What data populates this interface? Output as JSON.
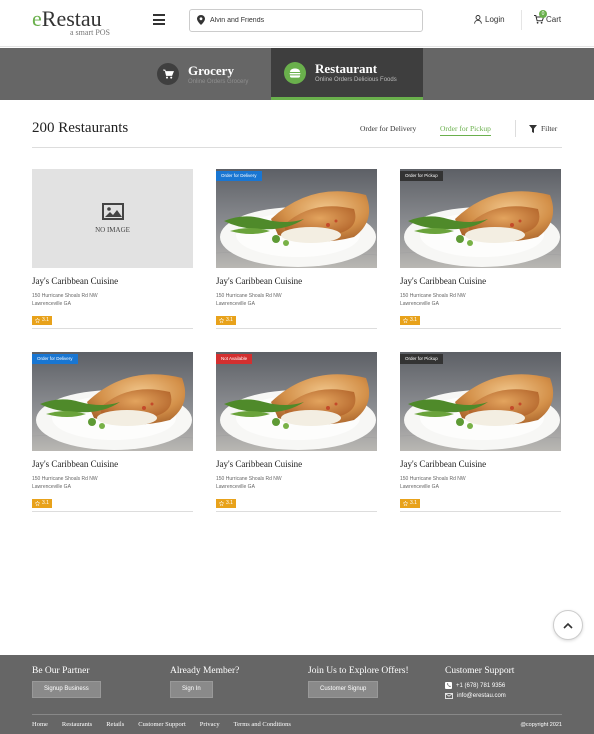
{
  "header": {
    "logo_main_e": "e",
    "logo_main_rest": "Restau",
    "logo_sub": "a smart POS",
    "search_value": "Alvin and Friends",
    "login_label": "Login",
    "cart_label": "Cart",
    "cart_count": "0",
    "accent_color": "#6ab04c"
  },
  "categories": [
    {
      "title": "Grocery",
      "subtitle": "Online Orders Grocery",
      "icon": "cart-icon"
    },
    {
      "title": "Restaurant",
      "subtitle": "Online Orders Delicious Foods",
      "icon": "burger-icon",
      "active": true
    }
  ],
  "toolbar": {
    "count_title": "200 Restaurants",
    "tab_delivery": "Order for Delivery",
    "tab_pickup": "Order for Pickup",
    "filter_label": "Filter"
  },
  "cards": [
    {
      "name": "Jay's Caribbean Cuisine",
      "addr1": "150 Hurricane Shoals Rd NW",
      "addr2": "Lawrenceville GA",
      "rating": "3.1",
      "badge": "",
      "image": "no-image",
      "noimage_label": "NO IMAGE"
    },
    {
      "name": "Jay's Caribbean Cuisine",
      "addr1": "150 Hurricane Shoals Rd NW",
      "addr2": "Lawrenceville GA",
      "rating": "3.1",
      "badge": "Order for Delivery",
      "badge_color": "#1976d2",
      "image": "food"
    },
    {
      "name": "Jay's Caribbean Cuisine",
      "addr1": "150 Hurricane Shoals Rd NW",
      "addr2": "Lawrenceville GA",
      "rating": "3.1",
      "badge": "Order for Pickup",
      "badge_color": "#333333",
      "image": "food"
    },
    {
      "name": "Jay's Caribbean Cuisine",
      "addr1": "150 Hurricane Shoals Rd NW",
      "addr2": "Lawrenceville GA",
      "rating": "3.1",
      "badge": "Order for Delivery",
      "badge_color": "#1976d2",
      "image": "food"
    },
    {
      "name": "Jay's Caribbean Cuisine",
      "addr1": "150 Hurricane Shoals Rd NW",
      "addr2": "Lawrenceville GA",
      "rating": "3.1",
      "badge": "Not Available",
      "badge_color": "#d32f2f",
      "image": "food"
    },
    {
      "name": "Jay's Caribbean Cuisine",
      "addr1": "150 Hurricane Shoals Rd NW",
      "addr2": "Lawrenceville GA",
      "rating": "3.1",
      "badge": "Order for Pickup",
      "badge_color": "#333333",
      "image": "food"
    }
  ],
  "footer": {
    "partner_title": "Be Our Partner",
    "partner_button": "Signup Business",
    "member_title": "Already Member?",
    "member_button": "Sign In",
    "offers_title": "Join Us to Explore Offers!",
    "offers_button": "Customer Signup",
    "support_title": "Customer Support",
    "support_phone": "+1 (678) 781 9356",
    "support_email": "info@erestau.com",
    "links": [
      "Home",
      "Restaurants",
      "Retails",
      "Customer Support",
      "Privacy",
      "Terms and Conditions"
    ],
    "copyright": "@copyright 2021"
  }
}
